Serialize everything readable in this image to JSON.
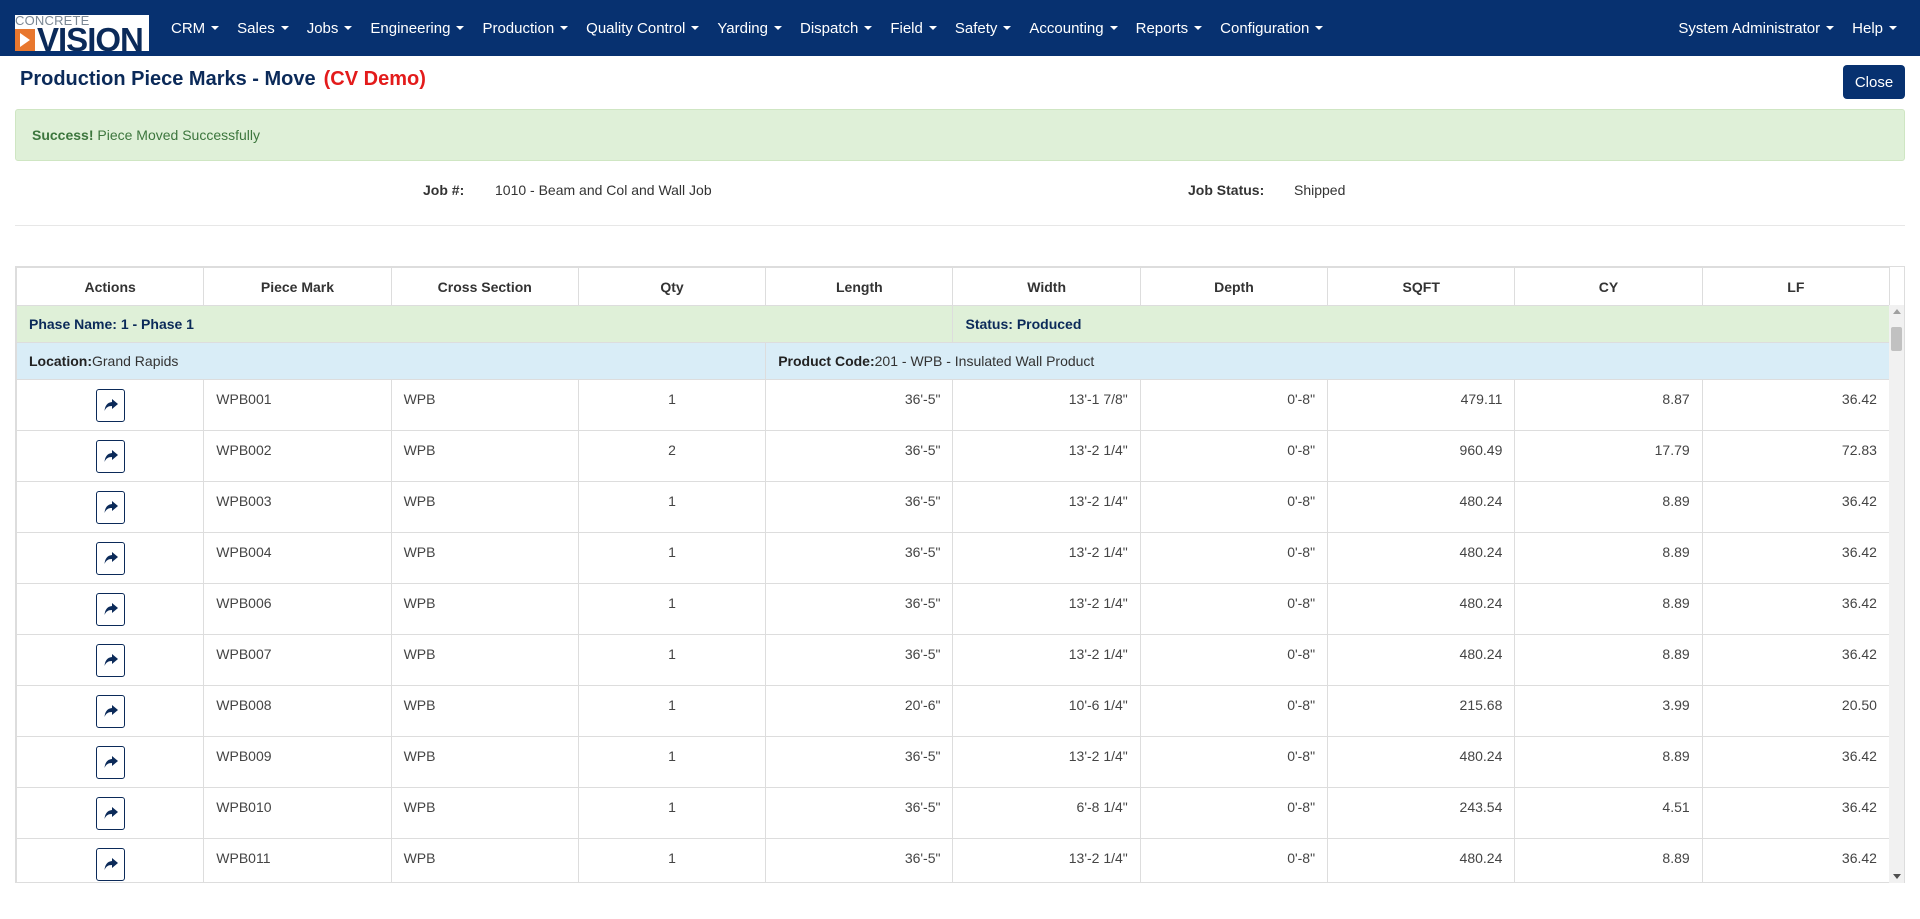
{
  "brand": {
    "top_text": "CONCRETE",
    "main_text": "VISION"
  },
  "nav": {
    "items": [
      "CRM",
      "Sales",
      "Jobs",
      "Engineering",
      "Production",
      "Quality Control",
      "Yarding",
      "Dispatch",
      "Field",
      "Safety",
      "Accounting",
      "Reports",
      "Configuration"
    ],
    "user": "System Administrator",
    "help": "Help"
  },
  "page": {
    "title": "Production Piece Marks - Move",
    "demo_tag": "(CV Demo)",
    "close_label": "Close"
  },
  "alert": {
    "strong": "Success!",
    "message": "Piece Moved Successfully"
  },
  "job": {
    "number_label": "Job #:",
    "number_value": "1010 - Beam and Col and Wall Job",
    "status_label": "Job Status:",
    "status_value": "Shipped"
  },
  "table": {
    "headers": [
      "Actions",
      "Piece Mark",
      "Cross Section",
      "Qty",
      "Length",
      "Width",
      "Depth",
      "SQFT",
      "CY",
      "LF"
    ],
    "phase_name": "Phase Name: 1 - Phase 1",
    "status": "Status: Produced",
    "location_label": "Location:",
    "location_value": "Grand Rapids",
    "product_code_label": "Product Code:",
    "product_code_value": "201 - WPB - Insulated Wall Product",
    "rows": [
      {
        "mark": "WPB001",
        "section": "WPB",
        "qty": "1",
        "length": "36'-5\"",
        "width": "13'-1 7/8\"",
        "depth": "0'-8\"",
        "sqft": "479.11",
        "cy": "8.87",
        "lf": "36.42"
      },
      {
        "mark": "WPB002",
        "section": "WPB",
        "qty": "2",
        "length": "36'-5\"",
        "width": "13'-2 1/4\"",
        "depth": "0'-8\"",
        "sqft": "960.49",
        "cy": "17.79",
        "lf": "72.83"
      },
      {
        "mark": "WPB003",
        "section": "WPB",
        "qty": "1",
        "length": "36'-5\"",
        "width": "13'-2 1/4\"",
        "depth": "0'-8\"",
        "sqft": "480.24",
        "cy": "8.89",
        "lf": "36.42"
      },
      {
        "mark": "WPB004",
        "section": "WPB",
        "qty": "1",
        "length": "36'-5\"",
        "width": "13'-2 1/4\"",
        "depth": "0'-8\"",
        "sqft": "480.24",
        "cy": "8.89",
        "lf": "36.42"
      },
      {
        "mark": "WPB006",
        "section": "WPB",
        "qty": "1",
        "length": "36'-5\"",
        "width": "13'-2 1/4\"",
        "depth": "0'-8\"",
        "sqft": "480.24",
        "cy": "8.89",
        "lf": "36.42"
      },
      {
        "mark": "WPB007",
        "section": "WPB",
        "qty": "1",
        "length": "36'-5\"",
        "width": "13'-2 1/4\"",
        "depth": "0'-8\"",
        "sqft": "480.24",
        "cy": "8.89",
        "lf": "36.42"
      },
      {
        "mark": "WPB008",
        "section": "WPB",
        "qty": "1",
        "length": "20'-6\"",
        "width": "10'-6 1/4\"",
        "depth": "0'-8\"",
        "sqft": "215.68",
        "cy": "3.99",
        "lf": "20.50"
      },
      {
        "mark": "WPB009",
        "section": "WPB",
        "qty": "1",
        "length": "36'-5\"",
        "width": "13'-2 1/4\"",
        "depth": "0'-8\"",
        "sqft": "480.24",
        "cy": "8.89",
        "lf": "36.42"
      },
      {
        "mark": "WPB010",
        "section": "WPB",
        "qty": "1",
        "length": "36'-5\"",
        "width": "6'-8 1/4\"",
        "depth": "0'-8\"",
        "sqft": "243.54",
        "cy": "4.51",
        "lf": "36.42"
      },
      {
        "mark": "WPB011",
        "section": "WPB",
        "qty": "1",
        "length": "36'-5\"",
        "width": "13'-2 1/4\"",
        "depth": "0'-8\"",
        "sqft": "480.24",
        "cy": "8.89",
        "lf": "36.42"
      }
    ]
  },
  "colors": {
    "navbar": "#073170",
    "title": "#0b2a59",
    "demo": "#e31b1b",
    "success_bg": "#dff0d8",
    "info_bg": "#d9edf7"
  },
  "icons": {
    "row_action": "share-arrow-icon"
  }
}
